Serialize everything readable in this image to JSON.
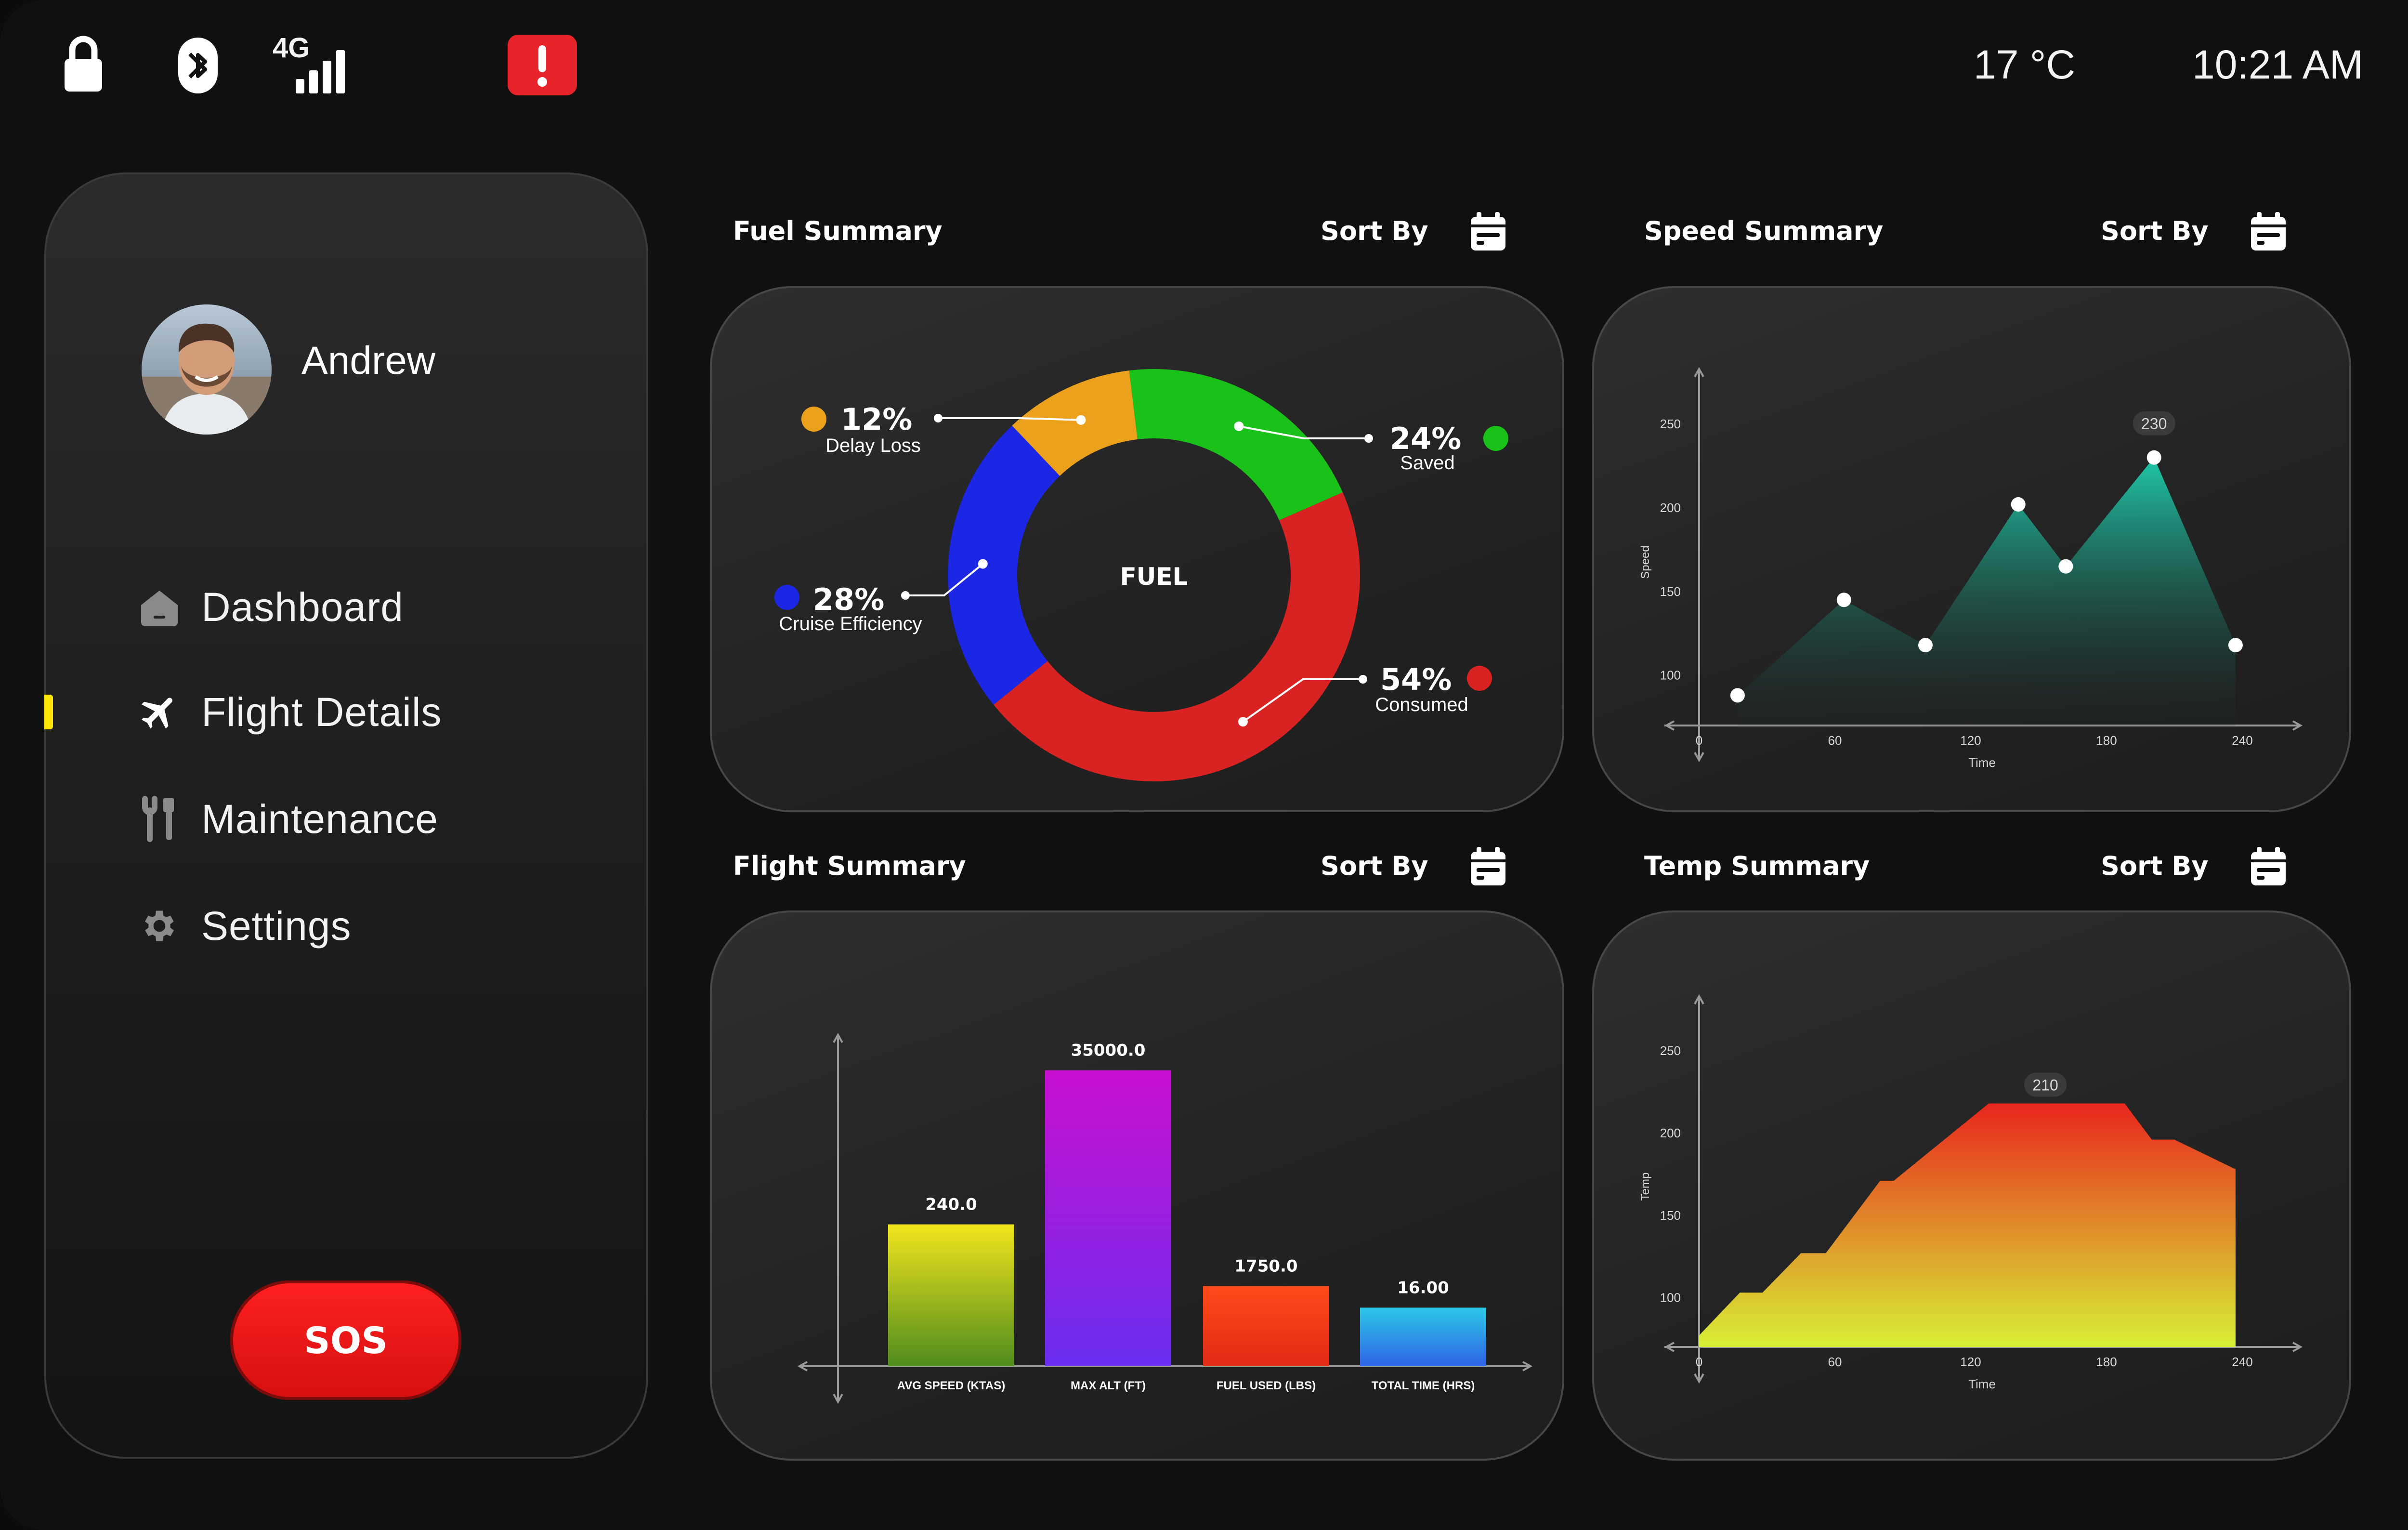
{
  "status_bar": {
    "network_label": "4G",
    "temperature": "17 °C",
    "time": "10:21 AM",
    "icons": [
      "lock-icon",
      "bluetooth-icon",
      "signal-icon",
      "alert-icon"
    ]
  },
  "sidebar": {
    "user_name": "Andrew",
    "nav": [
      {
        "label": "Dashboard",
        "icon": "home-icon"
      },
      {
        "label": "Flight Details",
        "icon": "airplane-icon",
        "active": true
      },
      {
        "label": "Maintenance",
        "icon": "tools-icon"
      },
      {
        "label": "Settings",
        "icon": "gear-icon"
      }
    ],
    "sos_label": "SOS"
  },
  "colors": {
    "accent_active": "#ffe500",
    "sos": "#e41616",
    "alert": "#e8242a"
  },
  "panels": {
    "fuel": {
      "title": "Fuel Summary",
      "sort_label": "Sort By"
    },
    "speed": {
      "title": "Speed Summary",
      "sort_label": "Sort By"
    },
    "flight": {
      "title": "Flight Summary",
      "sort_label": "Sort By"
    },
    "temp": {
      "title": "Temp Summary",
      "sort_label": "Sort By"
    }
  },
  "chart_data": [
    {
      "id": "fuel",
      "type": "pie",
      "center_label": "FUEL",
      "slices": [
        {
          "label": "Delay Loss",
          "percent_text": "12%",
          "value": 12,
          "color": "#eba11b"
        },
        {
          "label": "Saved",
          "percent_text": "24%",
          "value": 24,
          "color": "#19c119"
        },
        {
          "label": "Consumed",
          "percent_text": "54%",
          "value": 54,
          "color": "#d92323"
        },
        {
          "label": "Cruise Efficiency",
          "percent_text": "28%",
          "value": 28,
          "color": "#1c26e5"
        }
      ]
    },
    {
      "id": "speed",
      "type": "area",
      "xlabel": "Time",
      "ylabel": "Speed",
      "x_ticks": [
        "0",
        "60",
        "120",
        "180",
        "240"
      ],
      "y_ticks": [
        "100",
        "150",
        "200",
        "250"
      ],
      "xlim": [
        0,
        250
      ],
      "ylim": [
        70,
        265
      ],
      "x": [
        17,
        64,
        100,
        141,
        162,
        201,
        237
      ],
      "values": [
        88,
        145,
        118,
        202,
        165,
        230,
        118
      ],
      "peak_label": "230",
      "fill_top": "#1fc9a9",
      "fill_bottom": "#1b2b2a"
    },
    {
      "id": "flight",
      "type": "bar",
      "categories": [
        "AVG SPEED (KTAS)",
        "MAX ALT (FT)",
        "FUEL USED (LBS)",
        "TOTAL TIME (HRS)"
      ],
      "value_labels": [
        "240.0",
        "35000.0",
        "1750.0",
        "16.00"
      ],
      "display_heights": [
        0.46,
        0.96,
        0.26,
        0.19
      ],
      "gradients": [
        [
          "#f2e51d",
          "#4f8c1d"
        ],
        [
          "#c90fd0",
          "#6a2ef0"
        ],
        [
          "#ff4a1b",
          "#e02a14"
        ],
        [
          "#2bc8e6",
          "#2f63e8"
        ]
      ]
    },
    {
      "id": "temp",
      "type": "area",
      "xlabel": "Time",
      "ylabel": "Temp",
      "x_ticks": [
        "0",
        "60",
        "120",
        "180",
        "240"
      ],
      "y_ticks": [
        "100",
        "150",
        "200",
        "250"
      ],
      "xlim": [
        0,
        250
      ],
      "ylim": [
        70,
        265
      ],
      "x": [
        0,
        18,
        28,
        45,
        56,
        80,
        86,
        128,
        188,
        200,
        210,
        237
      ],
      "values": [
        77,
        103,
        103,
        127,
        127,
        171,
        171,
        218,
        218,
        196,
        196,
        178
      ],
      "peak_label": "210",
      "fill_top": "#e8261d",
      "fill_bottom": "#d8f036"
    }
  ]
}
